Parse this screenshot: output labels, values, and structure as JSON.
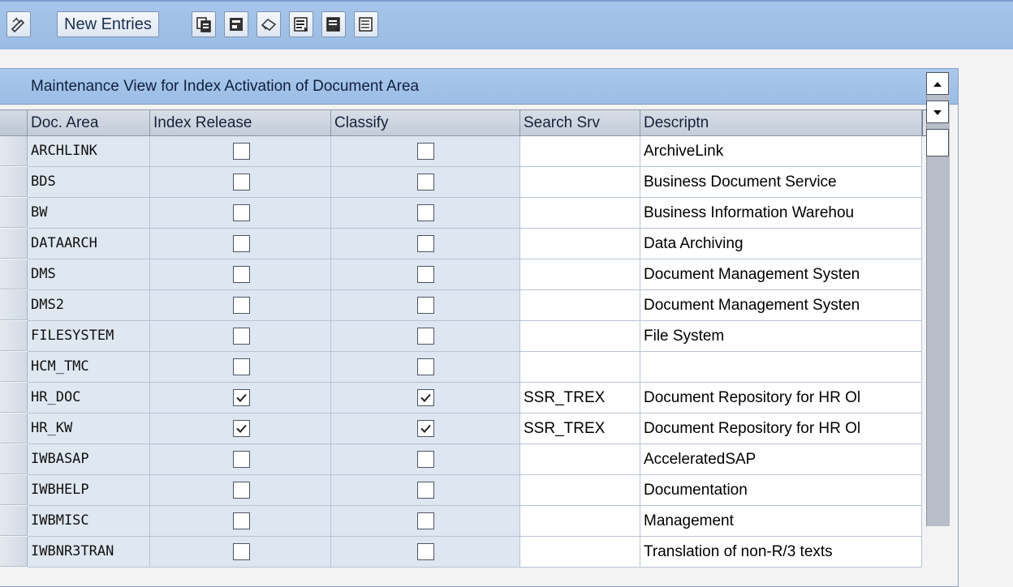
{
  "toolbar": {
    "new_entries_label": "New Entries",
    "icons": [
      "display-change-icon",
      "copy-icon",
      "delete-icon",
      "undo-icon",
      "select-all-icon",
      "select-block-icon",
      "deselect-all-icon"
    ]
  },
  "table": {
    "title": "Maintenance View for Index Activation of Document Area",
    "columns": {
      "doc_area": "Doc. Area",
      "index_release": "Index Release",
      "classify": "Classify",
      "search_srv": "Search Srv",
      "descriptn": "Descriptn"
    },
    "rows": [
      {
        "area": "ARCHLINK",
        "release": false,
        "classify": false,
        "srv": "",
        "desc": "ArchiveLink"
      },
      {
        "area": "BDS",
        "release": false,
        "classify": false,
        "srv": "",
        "desc": "Business Document Service"
      },
      {
        "area": "BW",
        "release": false,
        "classify": false,
        "srv": "",
        "desc": "Business Information Warehou"
      },
      {
        "area": "DATAARCH",
        "release": false,
        "classify": false,
        "srv": "",
        "desc": "Data Archiving"
      },
      {
        "area": "DMS",
        "release": false,
        "classify": false,
        "srv": "",
        "desc": "Document Management Systen"
      },
      {
        "area": "DMS2",
        "release": false,
        "classify": false,
        "srv": "",
        "desc": "Document Management Systen"
      },
      {
        "area": "FILESYSTEM",
        "release": false,
        "classify": false,
        "srv": "",
        "desc": "File System"
      },
      {
        "area": "HCM_TMC",
        "release": false,
        "classify": false,
        "srv": "",
        "desc": ""
      },
      {
        "area": "HR_DOC",
        "release": true,
        "classify": true,
        "srv": "SSR_TREX",
        "desc": "Document Repository for HR Ol"
      },
      {
        "area": "HR_KW",
        "release": true,
        "classify": true,
        "srv": "SSR_TREX",
        "desc": "Document Repository for HR Ol"
      },
      {
        "area": "IWBASAP",
        "release": false,
        "classify": false,
        "srv": "",
        "desc": "AcceleratedSAP"
      },
      {
        "area": "IWBHELP",
        "release": false,
        "classify": false,
        "srv": "",
        "desc": "Documentation"
      },
      {
        "area": "IWBMISC",
        "release": false,
        "classify": false,
        "srv": "",
        "desc": "Management"
      },
      {
        "area": "IWBNR3TRAN",
        "release": false,
        "classify": false,
        "srv": "",
        "desc": "Translation of non-R/3 texts"
      }
    ]
  }
}
